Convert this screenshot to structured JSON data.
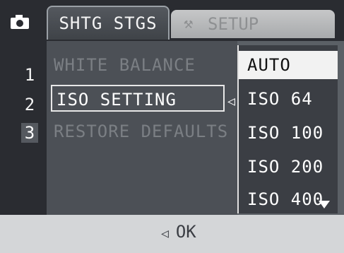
{
  "tabs": {
    "active_label": "SHTG STGS",
    "inactive_label": "SETUP"
  },
  "menu": {
    "numbers": [
      "1",
      "2",
      "3"
    ],
    "items": [
      "WHITE BALANCE",
      "ISO SETTING",
      "RESTORE DEFAULTS"
    ]
  },
  "options": [
    "AUTO",
    "ISO 64",
    "ISO 100",
    "ISO 200",
    "ISO 400"
  ],
  "footer": {
    "hint": "OK"
  },
  "icons": [
    "camera-icon",
    "wrench-icon",
    "left-arrow-icon",
    "scroll-down-icon"
  ]
}
